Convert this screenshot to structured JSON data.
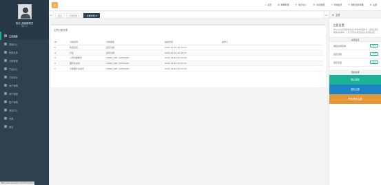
{
  "profile": {
    "name": "测试_超级管理员",
    "role": "简介 ▾"
  },
  "sidebar": {
    "items": [
      {
        "label": "主页面板"
      },
      {
        "label": "基础中心"
      },
      {
        "label": "数据总表"
      },
      {
        "label": "日程管理"
      },
      {
        "label": "产品中心"
      },
      {
        "label": "订单统计"
      },
      {
        "label": "用户管理"
      },
      {
        "label": "商户管理"
      },
      {
        "label": "账户管理"
      },
      {
        "label": "消息中心"
      },
      {
        "label": "设置"
      },
      {
        "label": "退出"
      }
    ],
    "status_url": "https://www.example.com/admin/index.html"
  },
  "topbar": {
    "toggle_icon": "≡",
    "links": [
      {
        "icon": "⌂",
        "label": "主页"
      },
      {
        "icon": "▤",
        "label": "数据管理"
      },
      {
        "icon": "✉",
        "label": "消息中心"
      },
      {
        "icon": "☏",
        "label": "在线客服"
      },
      {
        "icon": "✎",
        "label": "清除缓存"
      },
      {
        "icon": "⟳",
        "label": "刷新当前页面"
      },
      {
        "icon": "⚙",
        "label": "主题"
      }
    ]
  },
  "tabs": {
    "left_arrow": "◂◂",
    "right_arrow": "▸▸",
    "items": [
      {
        "label": "首页"
      },
      {
        "label": "分类管理 ×"
      },
      {
        "label": "文章分类 ⊗"
      }
    ]
  },
  "content": {
    "title": "文章分类列表",
    "columns": [
      "ID",
      "分类名称",
      "分类类型",
      "最新时间",
      "操作人"
    ],
    "rows": [
      {
        "id": "5",
        "name": "新闻资讯",
        "type": "资讯分类",
        "time": "2020-10-16 16:19:53",
        "op": ""
      },
      {
        "id": "4",
        "name": "行业",
        "type": "资讯分类",
        "time": "2020-12-16 16:16:07",
        "op": ""
      },
      {
        "id": "3",
        "name": "公司文章楼宇",
        "type": "TABLE_ART_CATEGORY",
        "time": "2020-12-02 09:15:26",
        "op": ""
      },
      {
        "id": "2",
        "name": "国际化资讯",
        "type": "TABLE_ART_CATEGORY",
        "time": "2020-12-02 09:12:23",
        "op": ""
      },
      {
        "id": "1",
        "name": "大数据平台资讯",
        "type": "TABLE_ART_CATEGORY",
        "time": "2020-12-02 09:12:19",
        "op": ""
      }
    ]
  },
  "rpanel": {
    "header": "主题",
    "title": "主题设置",
    "desc": "你可以从这里选择和预览主题的布局和样式，这些设置会被保存在本地，下次打开的时候会直接应用这些设置。",
    "section": "主题设置",
    "rows": [
      {
        "label": "收起左侧菜单",
        "value": "OFF"
      },
      {
        "label": "固定顶部",
        "value": "OFF"
      },
      {
        "label": "固定宽度",
        "value": "OFF"
      }
    ],
    "skin_title": "皮肤选择",
    "skins": [
      {
        "label": "默认皮肤"
      },
      {
        "label": "蓝色主题"
      },
      {
        "label": "黄色/紫色主题"
      }
    ]
  },
  "colors": {
    "sidebar": "#2f4050",
    "accent": "#1ab394",
    "toggle": "#f8ac59",
    "skin_blue": "#1c84c6",
    "skin_yellow": "#e59838"
  }
}
